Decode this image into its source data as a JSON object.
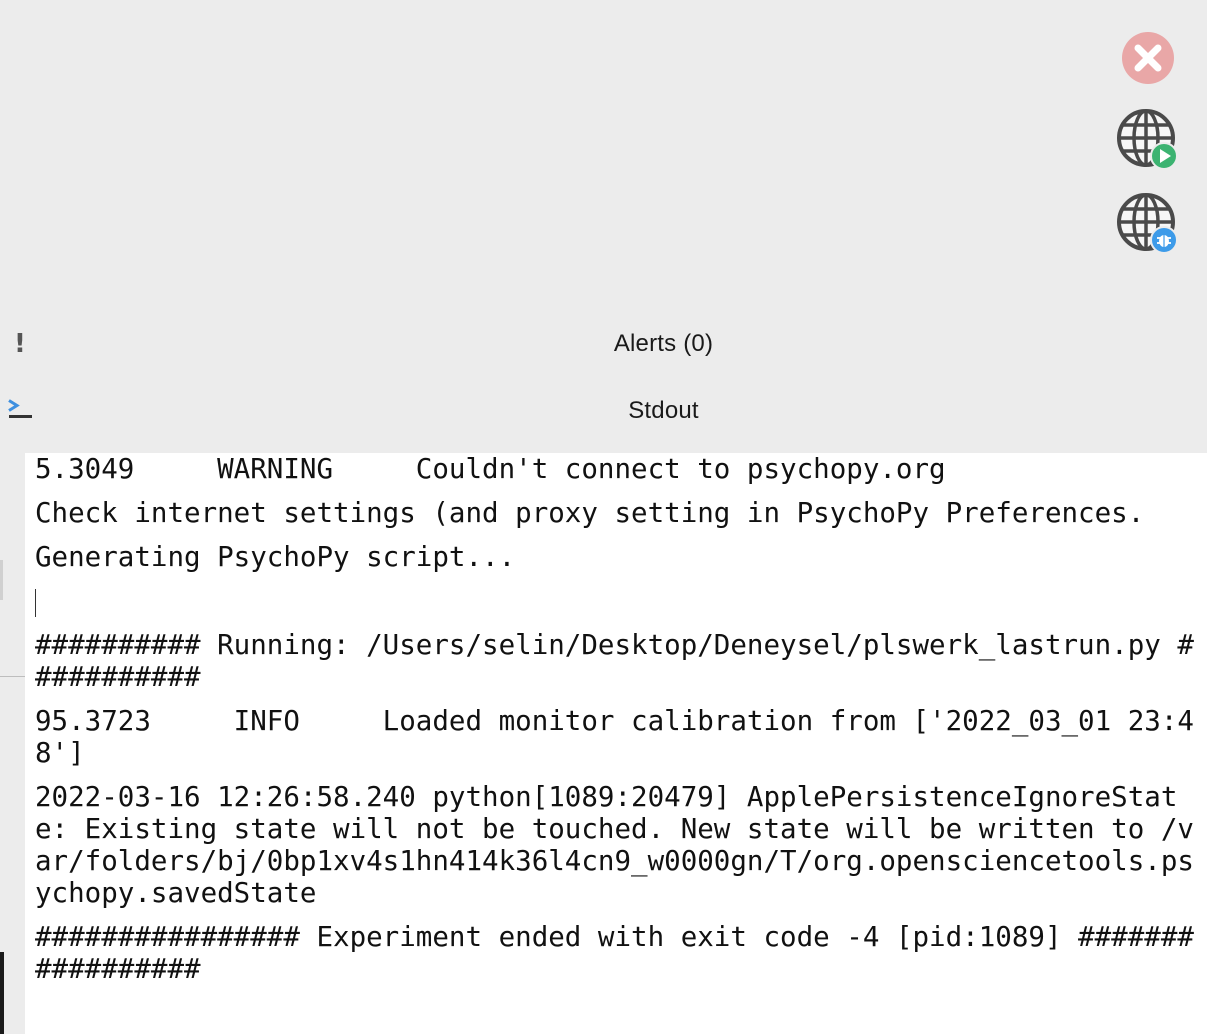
{
  "alerts_panel": {
    "icon": "exclamation-icon",
    "label": "Alerts (0)"
  },
  "stdout_panel": {
    "icon": "terminal-prompt-icon",
    "label": "Stdout",
    "lines": [
      "5.3049     WARNING     Couldn't connect to psychopy.org",
      "Check internet settings (and proxy setting in PsychoPy Preferences.",
      "Generating PsychoPy script...",
      "########## Running: /Users/selin/Desktop/Deneysel/plswerk_lastrun.py ###########",
      "95.3723     INFO     Loaded monitor calibration from ['2022_03_01 23:48']",
      "2022-03-16 12:26:58.240 python[1089:20479] ApplePersistenceIgnoreState: Existing state will not be touched. New state will be written to /var/folders/bj/0bp1xv4s1hn414k36l4cn9_w0000gn/T/org.opensciencetools.psychopy.savedState",
      "################ Experiment ended with exit code -4 [pid:1089] #################"
    ]
  },
  "toolbar": {
    "stop_icon": "stop-icon",
    "run_online_icon": "globe-run-icon",
    "debug_online_icon": "globe-debug-icon"
  },
  "colors": {
    "stop_red": "#e8a3a3",
    "run_green": "#3cb371",
    "debug_blue": "#3d9be9",
    "globe_gray": "#4a4a4a"
  }
}
